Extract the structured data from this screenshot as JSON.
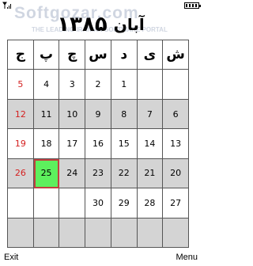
{
  "status_bar": {
    "signal_icon": "signal-icon",
    "battery_icon": "battery-icon"
  },
  "watermark": {
    "main": "Softgozar.com",
    "sub": "THE LEADING IRANIAN SOFTWARE PORTAL"
  },
  "header": {
    "month": "آبان",
    "year": "۱۳۸۵"
  },
  "calendar": {
    "weekdays": [
      "ج",
      "پ",
      "چ",
      "س",
      "د",
      "ی",
      "ش"
    ],
    "rows": [
      [
        "5",
        "4",
        "3",
        "2",
        "1",
        "",
        ""
      ],
      [
        "12",
        "11",
        "10",
        "9",
        "8",
        "7",
        "6"
      ],
      [
        "19",
        "18",
        "17",
        "16",
        "15",
        "14",
        "13"
      ],
      [
        "26",
        "25",
        "24",
        "23",
        "22",
        "21",
        "20"
      ],
      [
        "",
        "",
        "",
        "30",
        "29",
        "28",
        "27"
      ],
      [
        "",
        "",
        "",
        "",
        "",
        "",
        ""
      ]
    ],
    "today": "25"
  },
  "softkeys": {
    "left": "Exit",
    "right": "Menu"
  },
  "colors": {
    "friday": "#d42020",
    "today_fill": "#5df05d",
    "shaded": "#d4d4d4"
  }
}
